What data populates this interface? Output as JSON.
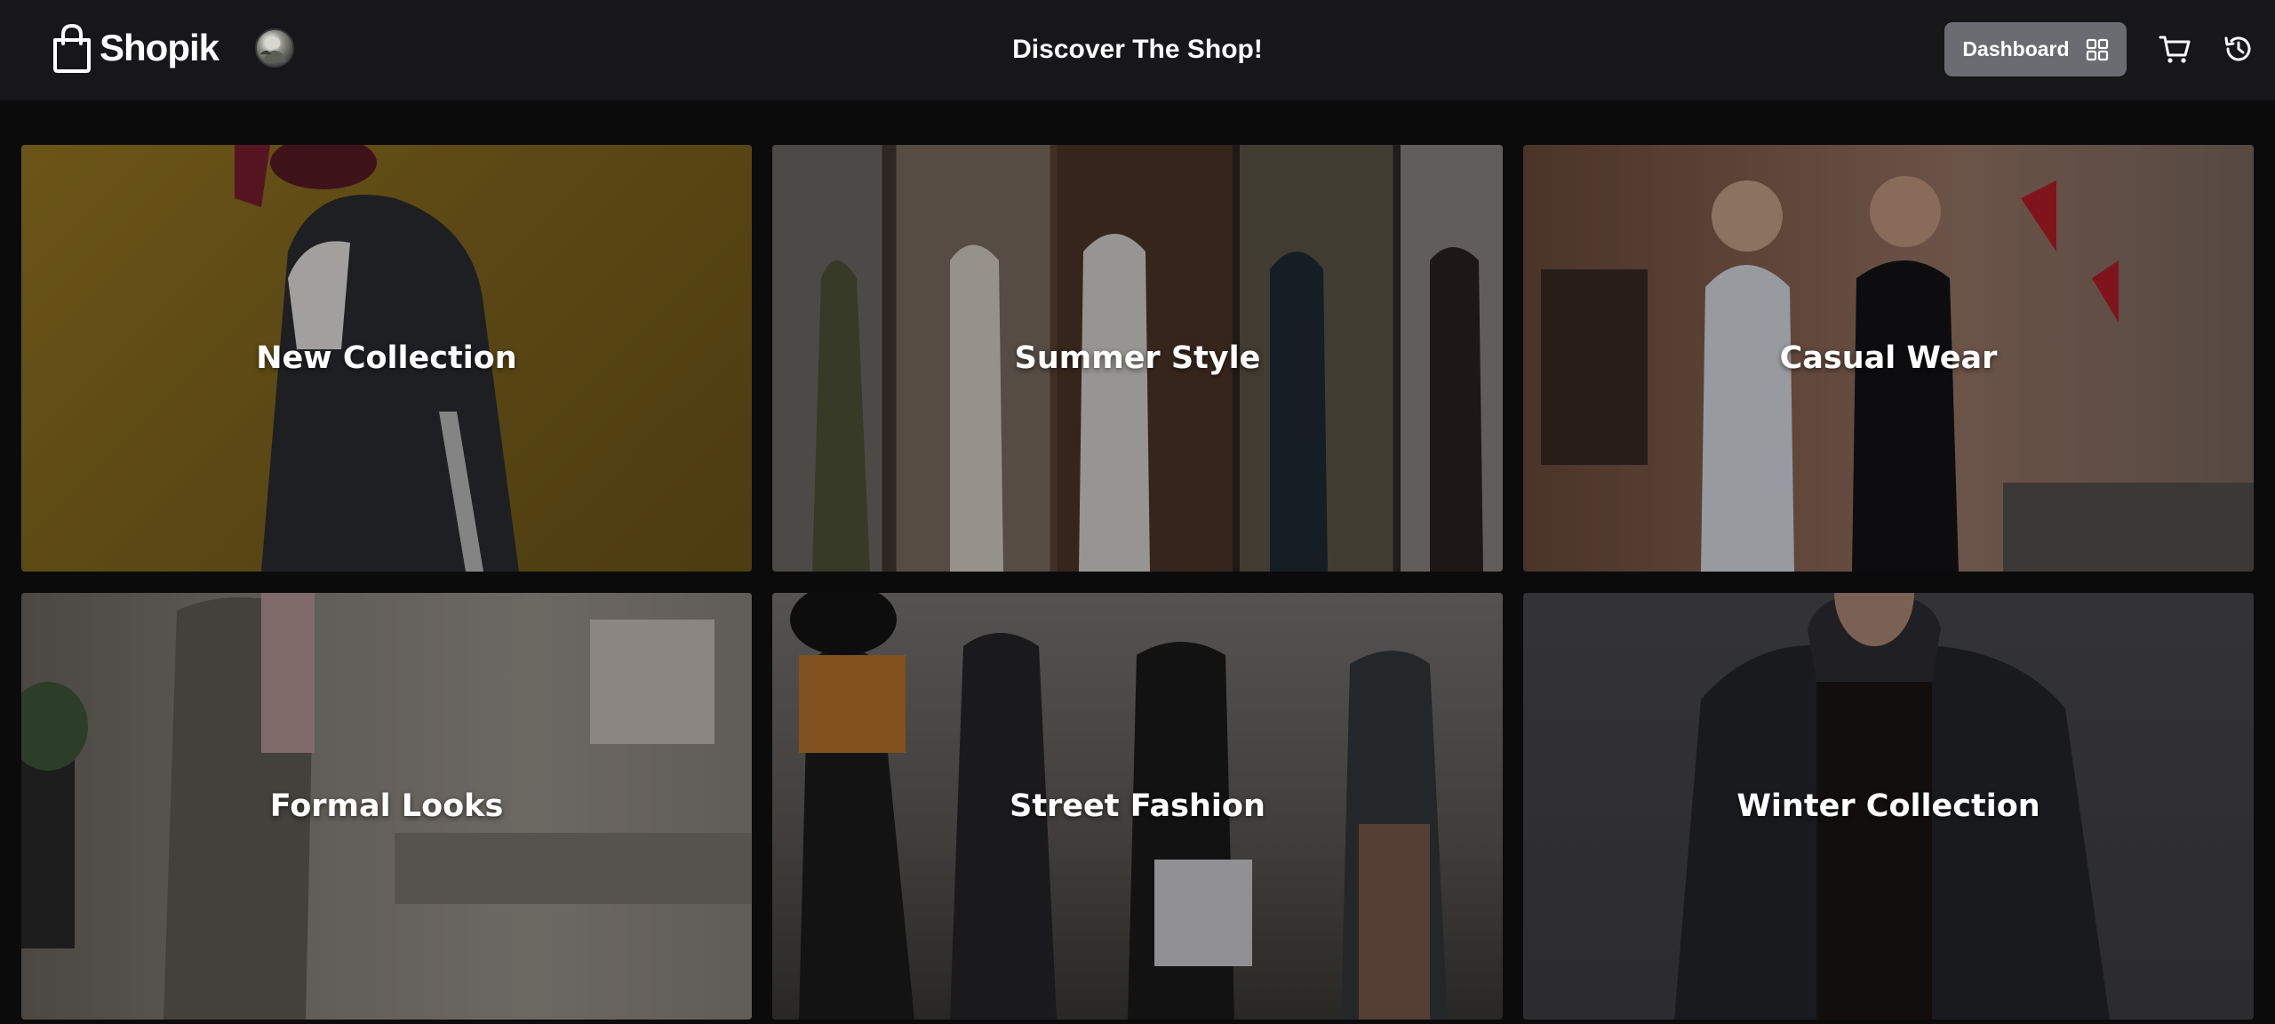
{
  "app": {
    "brand": "Shopik",
    "heading": "Discover The Shop!"
  },
  "header": {
    "dashboard_label": "Dashboard",
    "icons": [
      "shopping-bag-logo-icon",
      "avatar",
      "grid-icon",
      "cart-icon",
      "history-icon"
    ]
  },
  "categories": [
    {
      "label": "New Collection"
    },
    {
      "label": "Summer Style"
    },
    {
      "label": "Casual Wear"
    },
    {
      "label": "Formal Looks"
    },
    {
      "label": "Street Fashion"
    },
    {
      "label": "Winter Collection"
    }
  ],
  "colors": {
    "header_bg": "#17171a",
    "page_bg": "#0b0b0c",
    "button_bg": "#6b6b72",
    "text": "#ffffff"
  }
}
